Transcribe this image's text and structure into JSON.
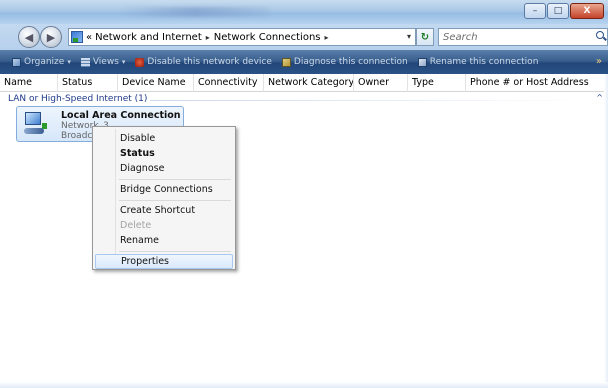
{
  "titlebar": {
    "caption_buttons": {
      "minimize": "–",
      "maximize": "□",
      "close": "X"
    }
  },
  "address": {
    "prefix": "«",
    "crumbs": [
      "Network and Internet",
      "Network Connections"
    ],
    "separator": "▸",
    "dropdown": "▾",
    "refresh": "↻"
  },
  "search": {
    "placeholder": "Search"
  },
  "commandbar": {
    "organize": "Organize",
    "views": "Views",
    "disable": "Disable this network device",
    "diagnose": "Diagnose this connection",
    "rename": "Rename this connection",
    "more": "»"
  },
  "columns": [
    "Name",
    "Status",
    "Device Name",
    "Connectivity",
    "Network Category",
    "Owner",
    "Type",
    "Phone # or Host Address"
  ],
  "group": {
    "title": "LAN or High-Speed Internet (1)",
    "caret": "^"
  },
  "item": {
    "name": "Local Area Connection",
    "network": "Network_3",
    "device": "Broadco"
  },
  "context_menu": {
    "items": [
      {
        "label": "Disable",
        "style": "normal"
      },
      {
        "label": "Status",
        "style": "bold"
      },
      {
        "label": "Diagnose",
        "style": "normal"
      },
      {
        "label": "Bridge Connections",
        "style": "normal"
      },
      {
        "label": "Create Shortcut",
        "style": "normal"
      },
      {
        "label": "Delete",
        "style": "disabled"
      },
      {
        "label": "Rename",
        "style": "normal"
      },
      {
        "label": "Properties",
        "style": "hover"
      }
    ]
  },
  "colors": {
    "titlebar": "#a9c8e6",
    "commandbar": "#2b5386",
    "menu_hover": "#d9e9fb",
    "group_text": "#1e3a8a"
  }
}
